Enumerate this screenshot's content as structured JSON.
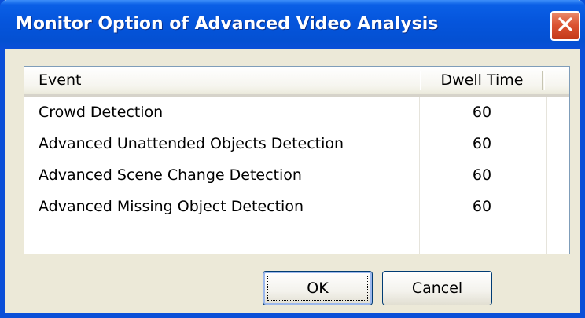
{
  "window": {
    "title": "Monitor Option of Advanced Video Analysis",
    "close_icon": "close-x-icon",
    "colors": {
      "titlebar": "#0555dc",
      "close_button": "#dc5432",
      "face": "#ece9d8"
    }
  },
  "list": {
    "columns": [
      "Event",
      "Dwell Time"
    ],
    "rows": [
      {
        "event": "Crowd Detection",
        "dwell": "60"
      },
      {
        "event": "Advanced Unattended Objects Detection",
        "dwell": "60"
      },
      {
        "event": "Advanced Scene Change Detection",
        "dwell": "60"
      },
      {
        "event": "Advanced Missing Object Detection",
        "dwell": "60"
      }
    ]
  },
  "buttons": {
    "ok": "OK",
    "cancel": "Cancel"
  }
}
